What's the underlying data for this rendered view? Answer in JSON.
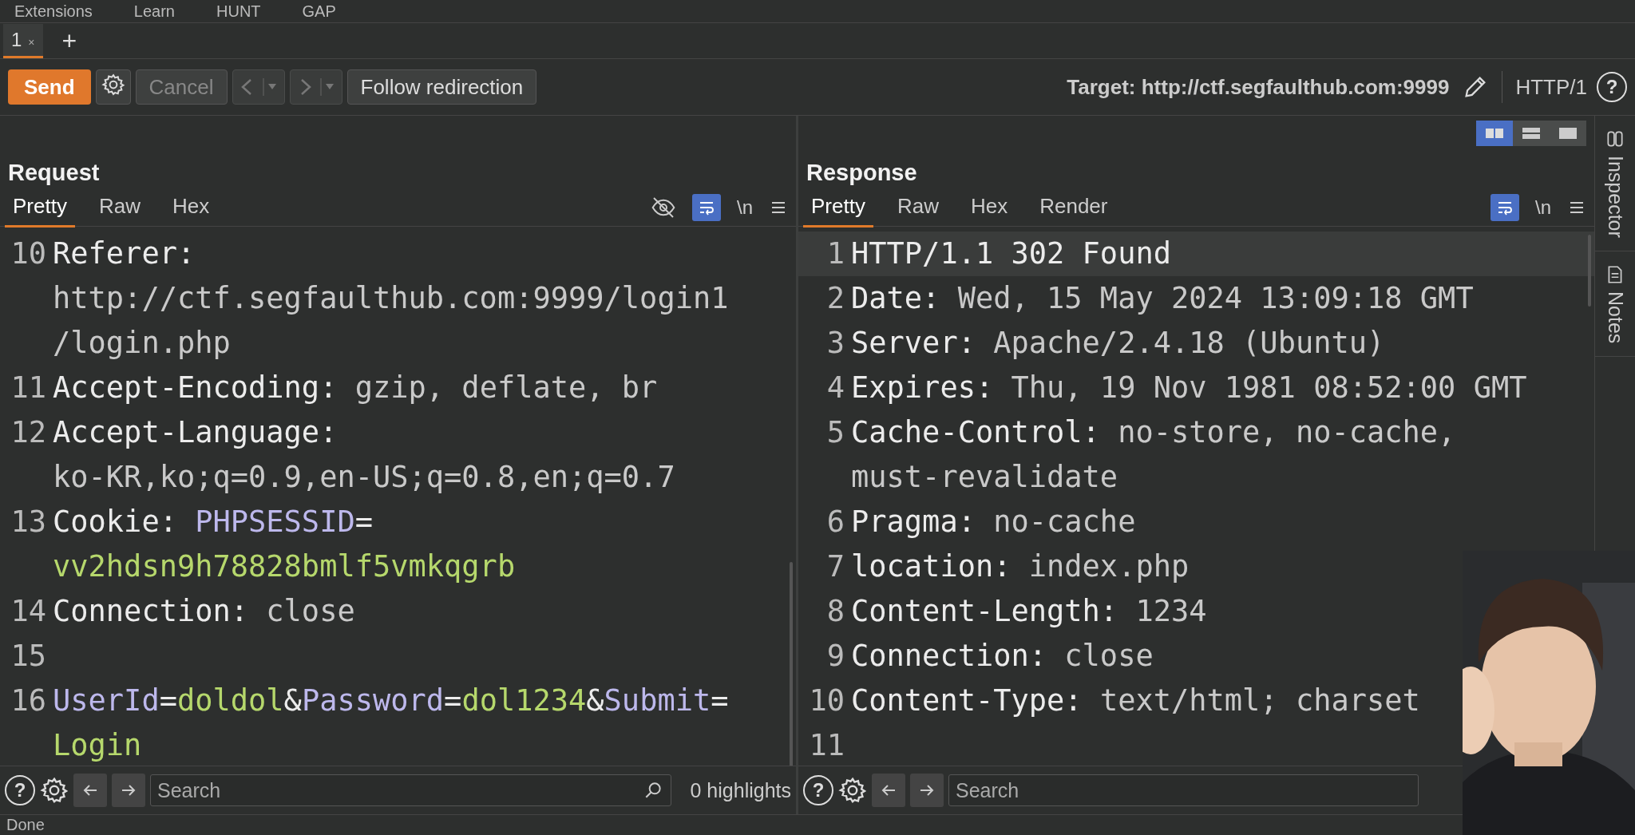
{
  "menu": [
    "Extensions",
    "Learn",
    "HUNT",
    "GAP"
  ],
  "tabs": [
    {
      "label": "1",
      "close": "×",
      "selected": true
    }
  ],
  "new_tab": "+",
  "toolbar": {
    "send": "Send",
    "cancel": "Cancel",
    "follow": "Follow redirection",
    "target": "Target: http://ctf.segfaulthub.com:9999",
    "protocol": "HTTP/1",
    "help": "?"
  },
  "layout_toggle": [
    {
      "selected": true
    },
    {
      "selected": false
    },
    {
      "selected": false
    }
  ],
  "request": {
    "title": "Request",
    "hide_icon": true,
    "wrap_on": true,
    "newline": "\\n",
    "views": [
      {
        "label": "Pretty",
        "selected": true
      },
      {
        "label": "Raw",
        "selected": false
      },
      {
        "label": "Hex",
        "selected": false
      }
    ],
    "lines": [
      {
        "num": "10",
        "current": false,
        "rows": [
          [
            {
              "kind": "name",
              "text": "Referer:"
            }
          ],
          [
            {
              "kind": "value",
              "text": "http://ctf.segfaulthub.com:9999/login1"
            }
          ],
          [
            {
              "kind": "value",
              "text": "/login.php"
            }
          ]
        ]
      },
      {
        "num": "11",
        "current": false,
        "rows": [
          [
            {
              "kind": "name",
              "text": "Accept-Encoding: "
            },
            {
              "kind": "value",
              "text": "gzip, deflate, br"
            }
          ]
        ]
      },
      {
        "num": "12",
        "current": false,
        "rows": [
          [
            {
              "kind": "name",
              "text": "Accept-Language:"
            }
          ],
          [
            {
              "kind": "value",
              "text": "ko-KR,ko;q=0.9,en-US;q=0.8,en;q=0.7"
            }
          ]
        ]
      },
      {
        "num": "13",
        "current": false,
        "rows": [
          [
            {
              "kind": "name",
              "text": "Cookie: "
            },
            {
              "kind": "param",
              "text": "PHPSESSID"
            },
            {
              "kind": "name",
              "text": "="
            }
          ],
          [
            {
              "kind": "paramval",
              "text": "vv2hdsn9h78828bmlf5vmkqgrb"
            }
          ]
        ]
      },
      {
        "num": "14",
        "current": false,
        "rows": [
          [
            {
              "kind": "name",
              "text": "Connection: "
            },
            {
              "kind": "value",
              "text": "close"
            }
          ]
        ]
      },
      {
        "num": "15",
        "current": false,
        "rows": [
          []
        ]
      },
      {
        "num": "16",
        "current": false,
        "rows": [
          [
            {
              "kind": "param",
              "text": "UserId"
            },
            {
              "kind": "name",
              "text": "="
            },
            {
              "kind": "paramval",
              "text": "doldol"
            },
            {
              "kind": "name",
              "text": "&"
            },
            {
              "kind": "param",
              "text": "Password"
            },
            {
              "kind": "name",
              "text": "="
            },
            {
              "kind": "paramval",
              "text": "dol1234"
            },
            {
              "kind": "name",
              "text": "&"
            },
            {
              "kind": "param",
              "text": "Submit"
            },
            {
              "kind": "name",
              "text": "="
            }
          ],
          [
            {
              "kind": "paramval",
              "text": "Login"
            }
          ]
        ]
      }
    ],
    "search": {
      "placeholder": "Search",
      "highlights": "0 highlights"
    }
  },
  "response": {
    "title": "Response",
    "wrap_on": true,
    "newline": "\\n",
    "views": [
      {
        "label": "Pretty",
        "selected": true
      },
      {
        "label": "Raw",
        "selected": false
      },
      {
        "label": "Hex",
        "selected": false
      },
      {
        "label": "Render",
        "selected": false
      }
    ],
    "lines": [
      {
        "num": "1",
        "current": true,
        "rows": [
          [
            {
              "kind": "name",
              "text": "HTTP/1.1 302 Found"
            }
          ]
        ]
      },
      {
        "num": "2",
        "current": false,
        "rows": [
          [
            {
              "kind": "name",
              "text": "Date: "
            },
            {
              "kind": "value",
              "text": "Wed, 15 May 2024 13:09:18 GMT"
            }
          ]
        ]
      },
      {
        "num": "3",
        "current": false,
        "rows": [
          [
            {
              "kind": "name",
              "text": "Server: "
            },
            {
              "kind": "value",
              "text": "Apache/2.4.18 (Ubuntu)"
            }
          ]
        ]
      },
      {
        "num": "4",
        "current": false,
        "rows": [
          [
            {
              "kind": "name",
              "text": "Expires: "
            },
            {
              "kind": "value",
              "text": "Thu, 19 Nov 1981 08:52:00 GMT"
            }
          ]
        ]
      },
      {
        "num": "5",
        "current": false,
        "rows": [
          [
            {
              "kind": "name",
              "text": "Cache-Control: "
            },
            {
              "kind": "value",
              "text": "no-store, no-cache,"
            }
          ],
          [
            {
              "kind": "value",
              "text": "must-revalidate"
            }
          ]
        ]
      },
      {
        "num": "6",
        "current": false,
        "rows": [
          [
            {
              "kind": "name",
              "text": "Pragma: "
            },
            {
              "kind": "value",
              "text": "no-cache"
            }
          ]
        ]
      },
      {
        "num": "7",
        "current": false,
        "rows": [
          [
            {
              "kind": "name",
              "text": "location: "
            },
            {
              "kind": "value",
              "text": "index.php"
            }
          ]
        ]
      },
      {
        "num": "8",
        "current": false,
        "rows": [
          [
            {
              "kind": "name",
              "text": "Content-Length: "
            },
            {
              "kind": "value",
              "text": "1234"
            }
          ]
        ]
      },
      {
        "num": "9",
        "current": false,
        "rows": [
          [
            {
              "kind": "name",
              "text": "Connection: "
            },
            {
              "kind": "value",
              "text": "close"
            }
          ]
        ]
      },
      {
        "num": "10",
        "current": false,
        "rows": [
          [
            {
              "kind": "name",
              "text": "Content-Type: "
            },
            {
              "kind": "value",
              "text": "text/html; charset"
            }
          ]
        ]
      },
      {
        "num": "11",
        "current": false,
        "rows": [
          []
        ]
      }
    ],
    "search": {
      "placeholder": "Search"
    }
  },
  "sidebar": [
    {
      "kind": "inspector",
      "label": "Inspector"
    },
    {
      "kind": "notes",
      "label": "Notes"
    }
  ],
  "status": "Done"
}
